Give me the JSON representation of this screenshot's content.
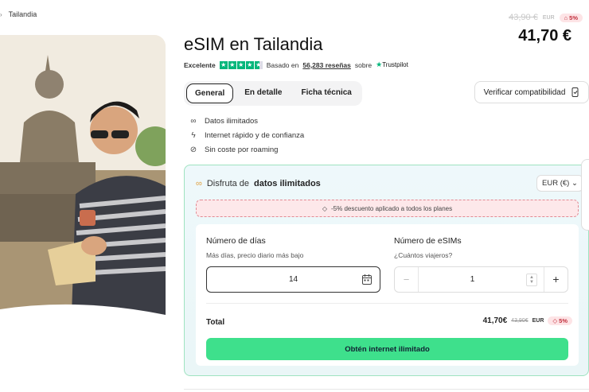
{
  "breadcrumb": {
    "separator": "›",
    "current": "Tailandia"
  },
  "product": {
    "title": "eSIM en Tailandia",
    "rating_label": "Excelente",
    "stars": 4.5,
    "based_prefix": "Basado en",
    "reviews": "56,283 reseñas",
    "based_suffix": "sobre",
    "trustpilot": "Trustpilot"
  },
  "price": {
    "old": "43,90 €",
    "currency_code": "EUR",
    "discount_badge": "5%",
    "current": "41,70 €"
  },
  "tabs": [
    {
      "label": "General",
      "active": true
    },
    {
      "label": "En detalle",
      "active": false
    },
    {
      "label": "Ficha técnica",
      "active": false
    }
  ],
  "verify_button": "Verificar compatibilidad",
  "features": [
    {
      "icon": "infinity-icon",
      "text": "Datos ilimitados"
    },
    {
      "icon": "lightning-icon",
      "text": "Internet rápido y de confianza"
    },
    {
      "icon": "no-roaming-icon",
      "text": "Sin coste por roaming"
    }
  ],
  "plan": {
    "heading_prefix": "Disfruta de",
    "heading_bold": "datos ilimitados",
    "currency_select": "EUR (€)",
    "discount_banner": "-5% descuento aplicado a todos los planes",
    "days_label": "Número de días",
    "days_sub": "Más días, precio diario más bajo",
    "days_value": "14",
    "esims_label": "Número de eSIMs",
    "esims_sub": "¿Cuántos viajeros?",
    "esims_value": "1",
    "total_label": "Total",
    "total_price": "41,70€",
    "total_old": "43,90€",
    "total_currency": "EUR",
    "total_badge": "5%",
    "cta": "Obtén internet ilimitado"
  },
  "colors": {
    "accent": "#3ee08c",
    "trustpilot": "#00b67a",
    "discount": "#c2303d"
  }
}
